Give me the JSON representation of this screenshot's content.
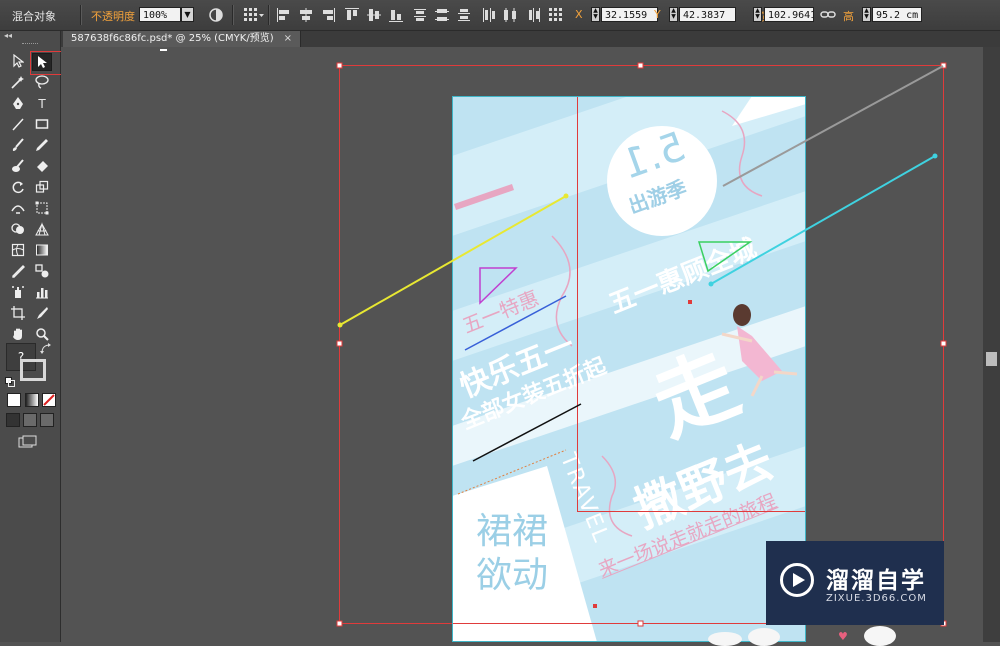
{
  "controlbar": {
    "object_type": "混合对象",
    "opacity_label": "不透明度",
    "opacity_value": "100%",
    "x_label": "X",
    "x_value": "32.1559",
    "y_label": "Y",
    "y_value": "42.3837",
    "w_label": "宽",
    "w_value": "102.9641",
    "h_label": "高",
    "h_value": "95.2 cm"
  },
  "tabbar": {
    "doc_title": "587638f6c86fc.psd* @ 25% (CMYK/预览)",
    "close": "×"
  },
  "toolpanel": {
    "collapse": "◂◂",
    "type_tool": "T",
    "unknown_help": "?"
  },
  "poster": {
    "date_badge": "5.1",
    "date_subtitle": "出游季",
    "headline_1": "五一惠顾全城",
    "headline_small": "五一特惠",
    "headline_2": "快乐五一",
    "headline_3": "全部女装五折起",
    "big_char": "走",
    "headline_4": "撒野去",
    "travel": "TRAVEL",
    "tagline": "来一场说走就走的旅程",
    "bottom_1": "裙裙",
    "bottom_2": "欲动"
  },
  "watermark": {
    "name": "溜溜自学",
    "url": "ZIXUE.3D66.COM"
  },
  "colors": {
    "accent_orange": "#f3a23b",
    "selection_red": "#e03b3b",
    "poster_bg": "#bfe3f2",
    "poster_pink": "#e7a6c2"
  }
}
